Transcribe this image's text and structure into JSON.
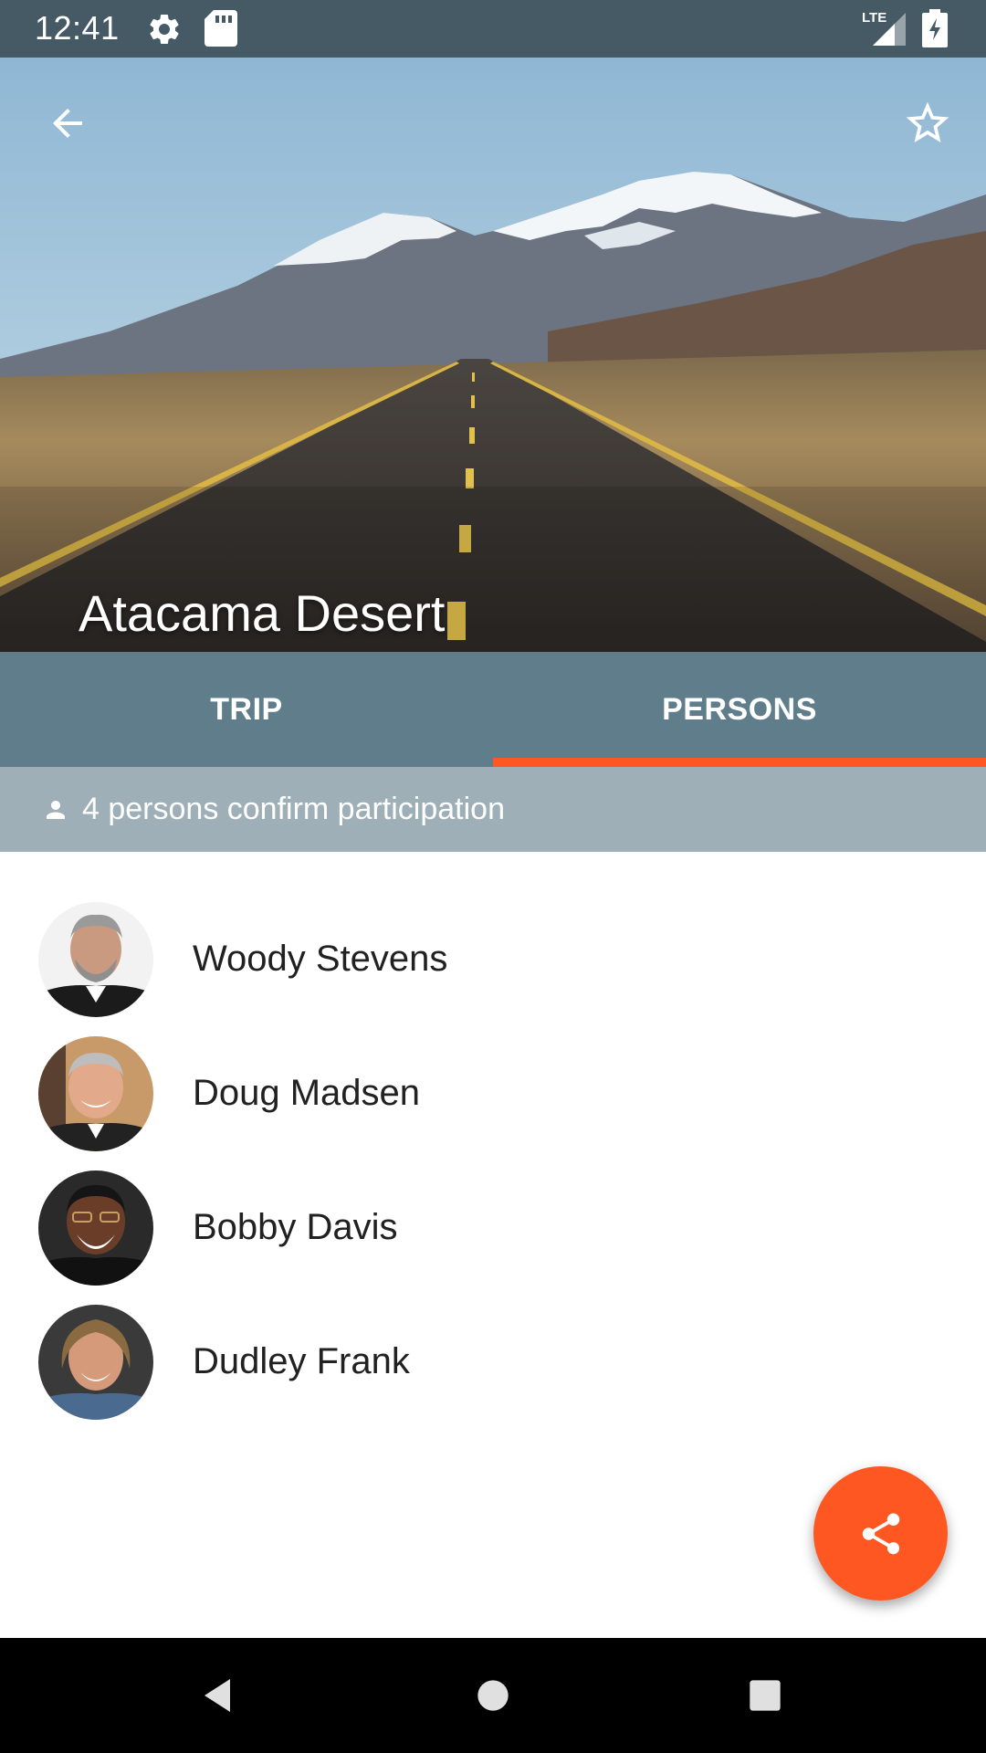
{
  "status_bar": {
    "time": "12:41",
    "network_label": "LTE",
    "icons": [
      "settings-icon",
      "sd-card-icon",
      "lte-signal-icon",
      "battery-charging-icon"
    ]
  },
  "hero": {
    "title": "Atacama Desert",
    "image": "desert-road-mountain-photo",
    "back_icon": "arrow-back-icon",
    "favorite_icon": "star-outline-icon"
  },
  "tabs": [
    {
      "label": "TRIP",
      "selected": false
    },
    {
      "label": "PERSONS",
      "selected": true
    }
  ],
  "info_banner": {
    "icon": "person-icon",
    "text": "4 persons confirm participation"
  },
  "persons": [
    {
      "name": "Woody Stevens"
    },
    {
      "name": "Doug Madsen"
    },
    {
      "name": "Bobby Davis"
    },
    {
      "name": "Dudley Frank"
    }
  ],
  "fab": {
    "icon": "share-icon"
  },
  "nav_bar": {
    "icons": [
      "nav-back-icon",
      "nav-home-icon",
      "nav-recents-icon"
    ]
  },
  "colors": {
    "status_bar": "#455a64",
    "tab_bar": "#607d8b",
    "accent": "#ff5722",
    "banner": "#9eafb8"
  }
}
